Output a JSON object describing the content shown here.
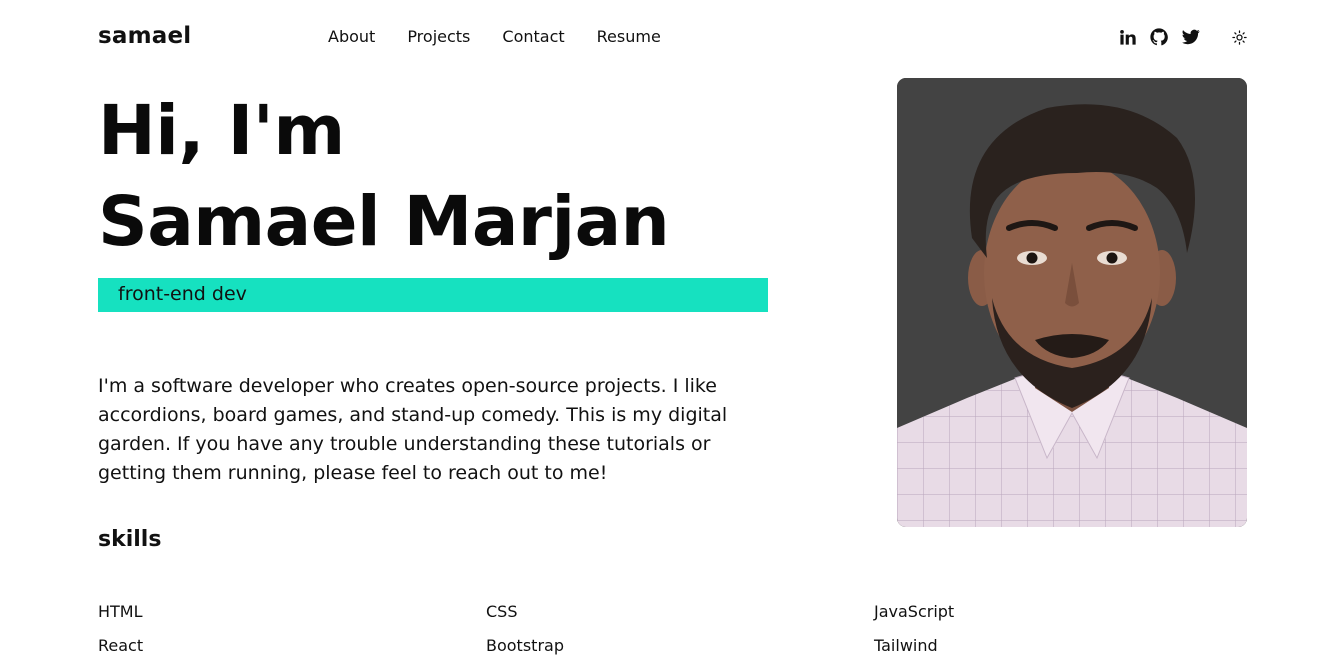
{
  "header": {
    "logo": "samael",
    "nav": [
      {
        "label": "About"
      },
      {
        "label": "Projects"
      },
      {
        "label": "Contact"
      },
      {
        "label": "Resume"
      }
    ],
    "social": [
      {
        "icon": "linkedin-icon"
      },
      {
        "icon": "github-icon"
      },
      {
        "icon": "twitter-icon"
      }
    ],
    "theme_icon": "sun-icon"
  },
  "hero": {
    "greeting": "Hi, I'm",
    "name": "Samael Marjan",
    "tagline": "front-end dev",
    "tagline_color": "#16e1c0",
    "bio": "I'm a software developer who creates open-source projects. I like accordions, board games, and stand-up comedy. This is my digital garden. If you have any trouble understanding these tutorials or getting them running, please feel to reach out to me!"
  },
  "skills": {
    "title": "skills",
    "items": [
      "HTML",
      "CSS",
      "JavaScript",
      "React",
      "Bootstrap",
      "Tailwind"
    ]
  },
  "photo": {
    "background": "#434343"
  }
}
